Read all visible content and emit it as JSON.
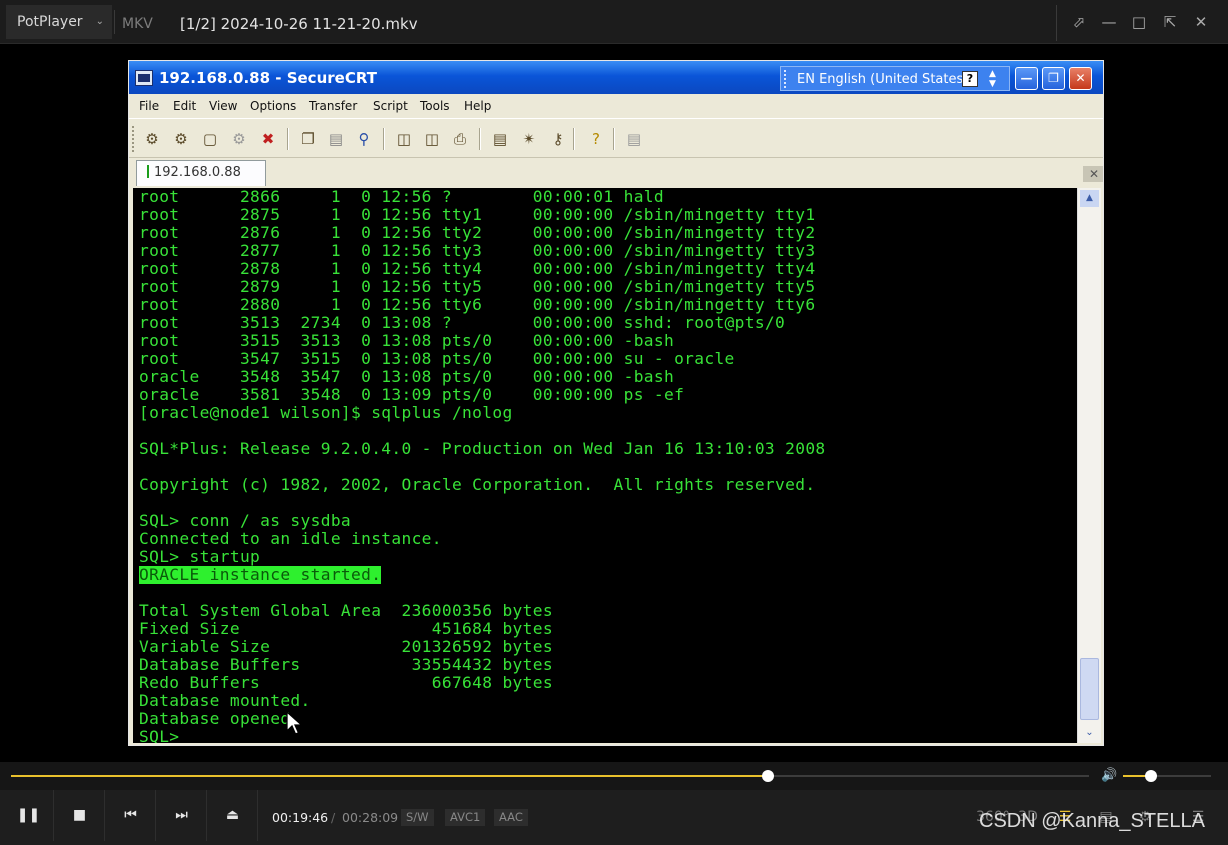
{
  "player": {
    "brand": "PotPlayer",
    "format": "MKV",
    "file_title": "[1/2] 2024-10-26 11-21-20.mkv",
    "time_current": "00:19:46",
    "time_separator": "/",
    "time_total": "00:28:09",
    "badges": [
      "S/W",
      "AVC1",
      "AAC"
    ],
    "progress_fraction": 0.702,
    "volume_fraction": 0.32,
    "accent_color": "#e9c12d",
    "right_icons": [
      "360°",
      "3D"
    ]
  },
  "crt": {
    "title": "192.168.0.88 - SecureCRT",
    "language": "EN English (United States)",
    "help_glyph": "?",
    "menu": [
      "File",
      "Edit",
      "View",
      "Options",
      "Transfer",
      "Script",
      "Tools",
      "Help"
    ],
    "tab_label": "192.168.0.88",
    "terminal_color": "#38e238",
    "terminal_lines": [
      "root      2866     1  0 12:56 ?        00:00:01 hald",
      "root      2875     1  0 12:56 tty1     00:00:00 /sbin/mingetty tty1",
      "root      2876     1  0 12:56 tty2     00:00:00 /sbin/mingetty tty2",
      "root      2877     1  0 12:56 tty3     00:00:00 /sbin/mingetty tty3",
      "root      2878     1  0 12:56 tty4     00:00:00 /sbin/mingetty tty4",
      "root      2879     1  0 12:56 tty5     00:00:00 /sbin/mingetty tty5",
      "root      2880     1  0 12:56 tty6     00:00:00 /sbin/mingetty tty6",
      "root      3513  2734  0 13:08 ?        00:00:00 sshd: root@pts/0",
      "root      3515  3513  0 13:08 pts/0    00:00:00 -bash",
      "root      3547  3515  0 13:08 pts/0    00:00:00 su - oracle",
      "oracle    3548  3547  0 13:08 pts/0    00:00:00 -bash",
      "oracle    3581  3548  0 13:09 pts/0    00:00:00 ps -ef",
      "[oracle@node1 wilson]$ sqlplus /nolog",
      "",
      "SQL*Plus: Release 9.2.0.4.0 - Production on Wed Jan 16 13:10:03 2008",
      "",
      "Copyright (c) 1982, 2002, Oracle Corporation.  All rights reserved.",
      "",
      "SQL> conn / as sysdba",
      "Connected to an idle instance.",
      "SQL> startup",
      "ORACLE instance started.",
      "",
      "Total System Global Area  236000356 bytes",
      "Fixed Size                   451684 bytes",
      "Variable Size             201326592 bytes",
      "Database Buffers           33554432 bytes",
      "Redo Buffers                 667648 bytes",
      "Database mounted.",
      "Database opened.",
      "SQL>"
    ],
    "highlighted_line_index": 21
  },
  "watermark": "CSDN @Kanna_STELLA"
}
